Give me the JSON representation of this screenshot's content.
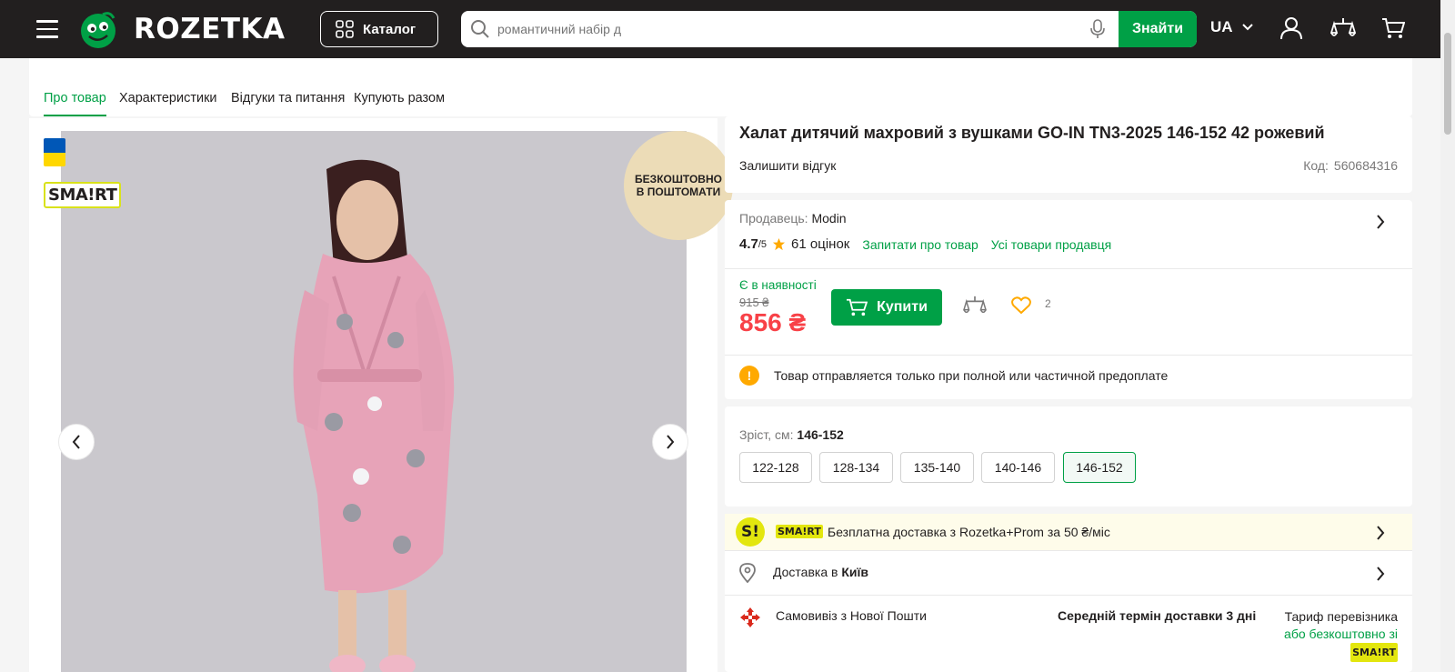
{
  "header": {
    "logo_text": "ROZETKA",
    "catalog_label": "Каталог",
    "search_placeholder": "романтичний набір д",
    "search_button": "Знайти",
    "language": "UA"
  },
  "tabs": [
    {
      "label": "Про товар",
      "active": true
    },
    {
      "label": "Характеристики",
      "active": false
    },
    {
      "label": "Відгуки та питання",
      "active": false
    },
    {
      "label": "Купують разом",
      "active": false
    }
  ],
  "gallery": {
    "smart_badge": "SMA!RT",
    "free_label_line1": "БЕЗКОШТОВНО",
    "free_label_line2": "В ПОШТОМАТИ"
  },
  "product": {
    "title": "Халат дитячий махровий з вушками GO-IN TN3-2025 146-152 42 рожевий",
    "review_link": "Залишити відгук",
    "code_label": "Код:",
    "code_value": "560684316"
  },
  "seller": {
    "label": "Продавець:",
    "name": "Modin",
    "rating": "4.7",
    "rating_max": "/5",
    "ratings_count": "61 оцінок",
    "ask_link": "Запитати про товар",
    "all_goods_link": "Усі товари продавця"
  },
  "purchase": {
    "stock_status": "Є в наявності",
    "old_price": "915 ₴",
    "price": "856 ₴",
    "buy_label": "Купити",
    "favorites_count": "2",
    "notice": "Товар отправляется только при полной или частичной предоплате"
  },
  "sizes": {
    "label": "Зріст, см:",
    "selected": "146-152",
    "options": [
      "122-128",
      "128-134",
      "135-140",
      "140-146",
      "146-152"
    ]
  },
  "delivery": {
    "smart_circle": "S!",
    "smart_mini": "SMA!RT",
    "smart_text": "Безплатна доставка з Rozetka+Prom за 50 ₴/міс",
    "delivery_prefix": "Доставка в",
    "city": "Київ",
    "np_method": "Самовивіз з Нової Пошти",
    "np_term": "Середній термін доставки 3 дні",
    "np_tariff": "Тариф перевізника",
    "np_free": "або безкоштовно зі",
    "np_smart": "SMA!RT"
  },
  "colors": {
    "brand_green": "#00a046",
    "price_red": "#f84147",
    "header_bg": "#221f1f",
    "warning": "#ffa900"
  }
}
